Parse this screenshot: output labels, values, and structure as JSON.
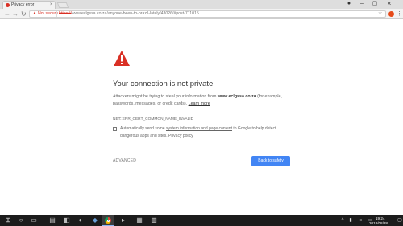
{
  "tab": {
    "title": "Privacy error",
    "close": "×"
  },
  "window": {
    "profile": "●",
    "minimize": "–",
    "maximize": "▢",
    "close": "×"
  },
  "toolbar": {
    "back": "←",
    "forward": "→",
    "reload": "↻",
    "security_label": "Not secure",
    "url_scheme": "https://",
    "url_rest": "www.eclgssa.co.za/anyone-been-to-brazil-lately/43026/#post-711015",
    "star": "☆",
    "menu": "⋮"
  },
  "interstitial": {
    "heading": "Your connection is not private",
    "para_before": "Attackers might be trying to steal your information from ",
    "para_domain": "www.eclgssa.co.za",
    "para_after": " (for example, passwords, messages, or credit cards). ",
    "para_link": "Learn more",
    "error_code": "NET::ERR_CERT_COMMON_NAME_INVALID",
    "optin_before": "Automatically send some ",
    "optin_link": "system information and page content",
    "optin_middle": " to Google to help detect dangerous apps and sites. ",
    "optin_privacy": "Privacy policy",
    "advanced": "ADVANCED",
    "back_to_safety": "Back to safety"
  },
  "taskbar": {
    "start": "⊞",
    "search": "○",
    "taskview": "▭",
    "tray_up": "^",
    "tray_net": "▮",
    "tray_vol": "◃",
    "tray_kbd": "▭",
    "time": "19:24",
    "date": "2018/08/28",
    "notifications": "▢"
  },
  "colors": {
    "danger": "#d93025",
    "primary_button": "#4285f4",
    "taskbar": "#1c1c1c"
  }
}
